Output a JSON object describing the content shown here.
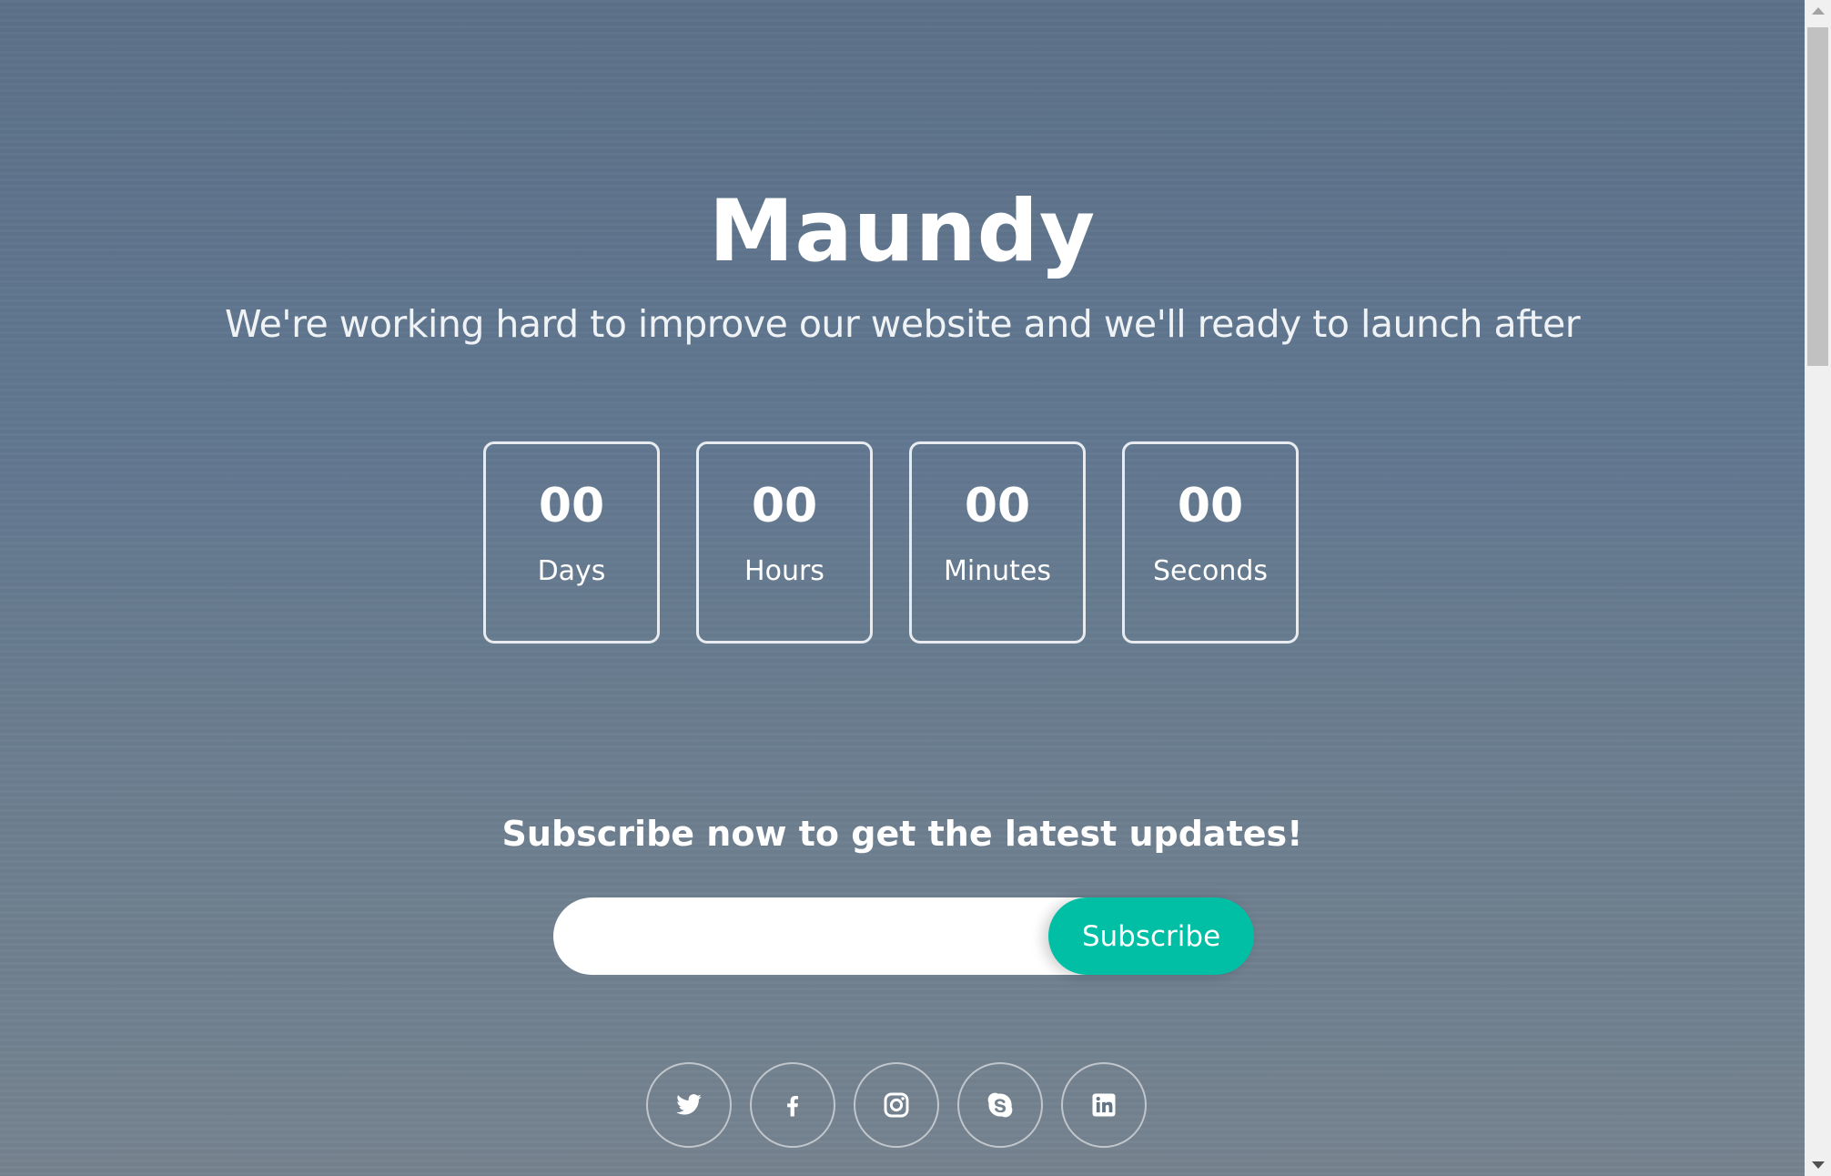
{
  "brand": {
    "title": "Maundy"
  },
  "hero": {
    "tagline": "We're working hard to improve our website and we'll ready to launch after"
  },
  "countdown": [
    {
      "value": "00",
      "label": "Days"
    },
    {
      "value": "00",
      "label": "Hours"
    },
    {
      "value": "00",
      "label": "Minutes"
    },
    {
      "value": "00",
      "label": "Seconds"
    }
  ],
  "subscribe": {
    "heading": "Subscribe now to get the latest updates!",
    "email_value": "",
    "email_placeholder": "",
    "button_label": "Subscribe"
  },
  "social": [
    {
      "icon": "twitter-icon"
    },
    {
      "icon": "facebook-icon"
    },
    {
      "icon": "instagram-icon"
    },
    {
      "icon": "skype-icon"
    },
    {
      "icon": "linkedin-icon"
    }
  ],
  "colors": {
    "accent": "#00bfa5",
    "background_top": "#5c7288",
    "background_bottom": "#76838f",
    "text": "#ffffff"
  }
}
